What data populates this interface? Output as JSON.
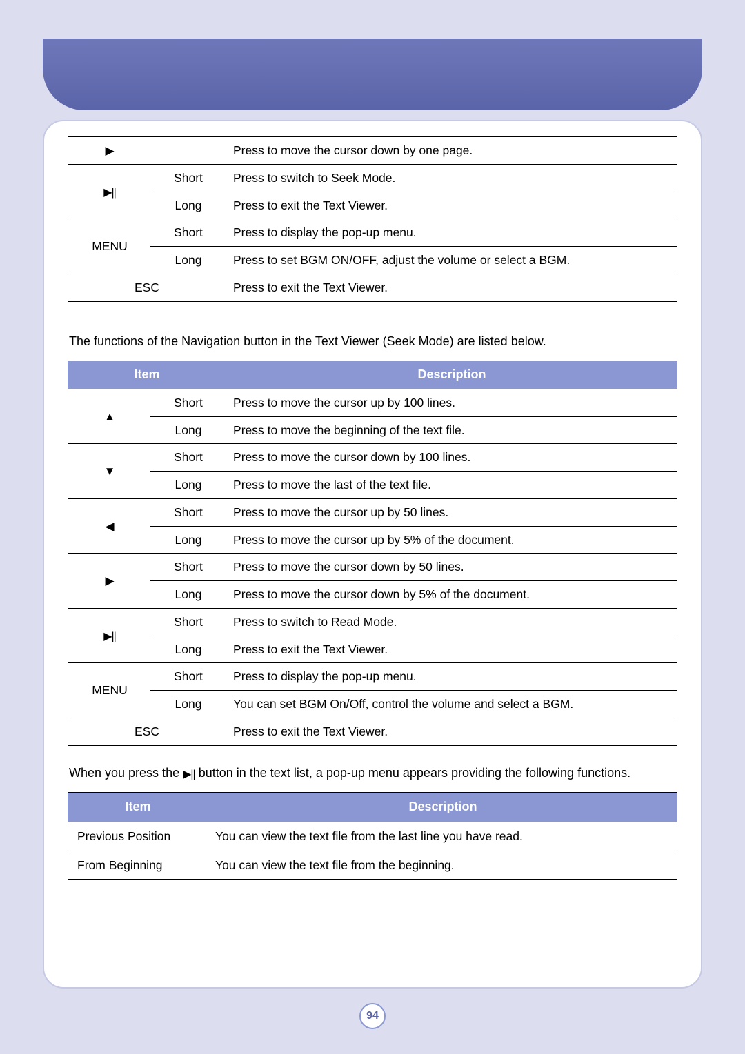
{
  "page_number": "94",
  "table1": {
    "rows": [
      {
        "icon": "right",
        "dur": "",
        "desc": "Press to move the cursor down by one page."
      },
      {
        "icon": "playpause",
        "dur": "Short",
        "desc": "Press to switch to Seek Mode."
      },
      {
        "icon": "",
        "dur": "Long",
        "desc": "Press to exit the Text Viewer."
      },
      {
        "icon": "MENU",
        "dur": "Short",
        "desc": "Press to display the pop-up menu."
      },
      {
        "icon": "",
        "dur": "Long",
        "desc": "Press to set BGM ON/OFF, adjust the volume or select a BGM."
      },
      {
        "icon": "ESC",
        "dur": "",
        "desc": "Press to exit the Text Viewer."
      }
    ]
  },
  "intro_seek": "The functions of the Navigation button in the Text Viewer (Seek Mode) are listed below.",
  "table2": {
    "head_item": "Item",
    "head_desc": "Description",
    "rows": [
      {
        "icon": "up",
        "dur": "Short",
        "desc": "Press to move the cursor up by 100 lines."
      },
      {
        "icon": "",
        "dur": "Long",
        "desc": "Press to move the beginning of the text file."
      },
      {
        "icon": "down",
        "dur": "Short",
        "desc": "Press to move the cursor down by 100 lines."
      },
      {
        "icon": "",
        "dur": "Long",
        "desc": "Press to move the last of the text file."
      },
      {
        "icon": "left",
        "dur": "Short",
        "desc": "Press to move the cursor up by 50 lines."
      },
      {
        "icon": "",
        "dur": "Long",
        "desc": "Press to move the cursor up by 5% of the document."
      },
      {
        "icon": "right",
        "dur": "Short",
        "desc": "Press to move the cursor down by 50 lines."
      },
      {
        "icon": "",
        "dur": "Long",
        "desc": "Press to move the cursor down by 5% of the document."
      },
      {
        "icon": "playpause",
        "dur": "Short",
        "desc": "Press to switch to Read Mode."
      },
      {
        "icon": "",
        "dur": "Long",
        "desc": "Press to exit the Text Viewer."
      },
      {
        "icon": "MENU",
        "dur": "Short",
        "desc": "Press to display the pop-up menu."
      },
      {
        "icon": "",
        "dur": "Long",
        "desc": "You can set BGM On/Off, control the volume and select a BGM."
      },
      {
        "icon": "ESC",
        "dur": "",
        "desc": "Press to exit the Text Viewer."
      }
    ]
  },
  "intro_popup_a": "When you press the ",
  "intro_popup_b": " button in the text list, a pop-up menu appears providing the following functions.",
  "table3": {
    "head_item": "Item",
    "head_desc": "Description",
    "rows": [
      {
        "item": "Previous Position",
        "desc": "You can view the text file from the last line you have read."
      },
      {
        "item": "From Beginning",
        "desc": "You can view the text file from the beginning."
      }
    ]
  }
}
